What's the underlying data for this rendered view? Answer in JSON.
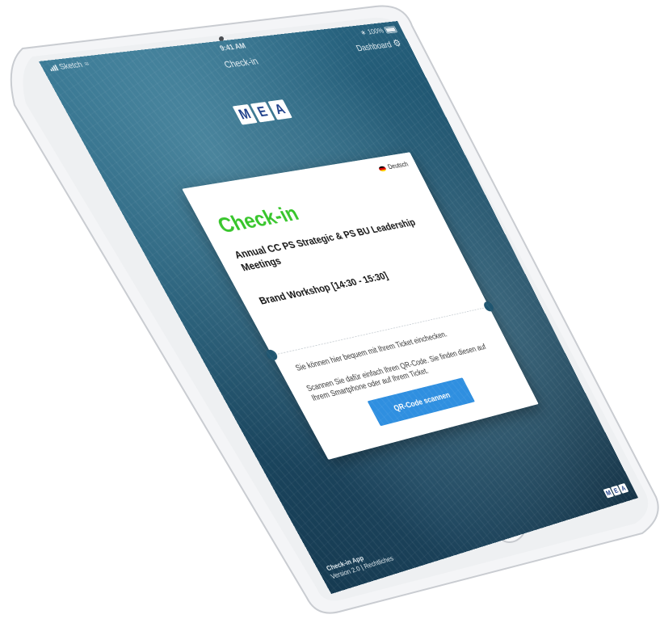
{
  "status_bar": {
    "carrier": "Sketch",
    "time": "9:41 AM",
    "battery": "100%"
  },
  "nav": {
    "title": "Check-in",
    "dashboard_label": "Dashboard",
    "gear_icon": "gear-icon"
  },
  "logo": {
    "letters": [
      "M",
      "E",
      "A"
    ]
  },
  "card": {
    "language": "Deutsch",
    "title": "Check-in",
    "event_name": "Annual CC PS Strategic & PS BU Leadership Meetings",
    "session_name": "Brand Workshop [14:30 - 15:30]",
    "info_line_1": "Sie können hier bequem mit Ihrem Ticket einchecken.",
    "info_line_2": "Scannen Sie dafür einfach Ihren QR-Code. Sie finden diesen auf Ihrem Smartphone oder auf Ihrem Ticket.",
    "scan_button": "QR-Code scannen"
  },
  "footer": {
    "app_name": "Check-in App",
    "version": "Version 2.0",
    "separator": "|",
    "legal": "Rechtliches"
  },
  "colors": {
    "title_green": "#36c52a",
    "button_blue": "#2f8fe0",
    "logo_blue": "#1e3f8a"
  }
}
